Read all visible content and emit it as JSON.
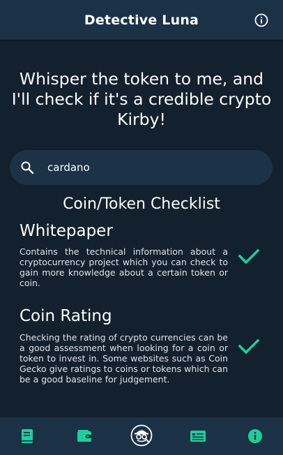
{
  "appbar": {
    "title": "Detective Luna",
    "info_icon": "info-outline-icon"
  },
  "headline": "Whisper the token to me, and I'll check if it's a credible crypto Kirby!",
  "search": {
    "value": "cardano",
    "icon": "search-icon"
  },
  "checklist": {
    "title": "Coin/Token Checklist",
    "items": [
      {
        "title": "Whitepaper",
        "description": "Contains the technical information about a cryptocurrency project which you can check to gain more knowledge about a certain token or coin.",
        "checked": true
      },
      {
        "title": "Coin Rating",
        "description": "Checking the rating of crypto currencies can be a good assessment when looking for a coin or token to invest in. Some websites such as Coin Gecko give ratings to coins or tokens which can be a good baseline for judgement.",
        "checked": true
      }
    ]
  },
  "navbar": {
    "items": [
      "book-icon",
      "wallet-icon",
      "detective-icon",
      "news-icon",
      "info-icon"
    ]
  },
  "colors": {
    "accent": "#1fcf9a",
    "bar": "#1b3146",
    "background": "#13202e"
  }
}
